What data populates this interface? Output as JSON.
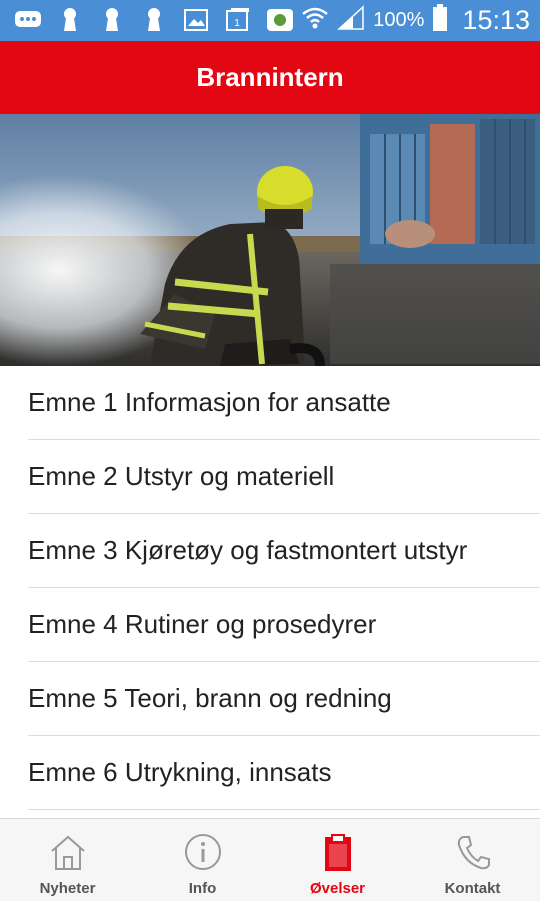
{
  "status_bar": {
    "battery_percent": "100%",
    "time": "15:13"
  },
  "app_bar": {
    "title": "Brannintern"
  },
  "topics": [
    {
      "label": "Emne 1 Informasjon for ansatte"
    },
    {
      "label": "Emne 2 Utstyr og materiell"
    },
    {
      "label": "Emne 3 Kjøretøy og fastmontert utstyr"
    },
    {
      "label": "Emne 4 Rutiner og prosedyrer"
    },
    {
      "label": "Emne 5 Teori, brann og redning"
    },
    {
      "label": "Emne 6 Utrykning, innsats"
    }
  ],
  "bottom_nav": {
    "active_tab": "Øvelser",
    "tabs": [
      {
        "label": "Nyheter",
        "icon": "home-icon"
      },
      {
        "label": "Info",
        "icon": "info-icon"
      },
      {
        "label": "Øvelser",
        "icon": "clipboard-icon"
      },
      {
        "label": "Kontakt",
        "icon": "phone-icon"
      }
    ]
  },
  "colors": {
    "status_bar": "#4a8fd6",
    "brand_red": "#e30613",
    "nav_background": "#f6f6f6"
  }
}
